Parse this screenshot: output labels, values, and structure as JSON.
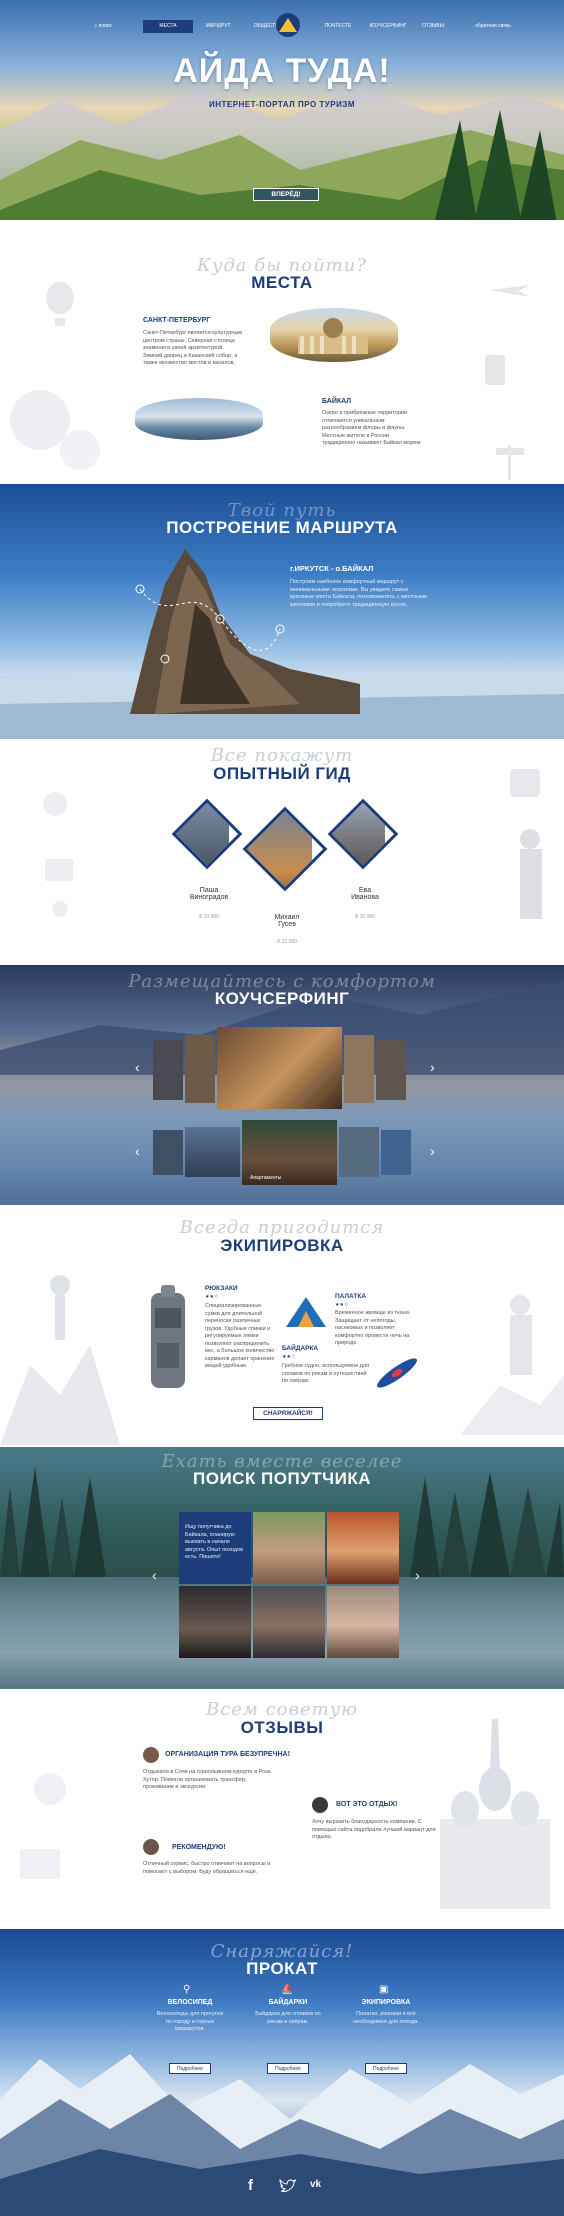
{
  "nav": {
    "search_placeholder": "поиск",
    "items": [
      "МЕСТА",
      "МАРШРУТ",
      "ОБЩЕСТВО",
      "ПОЧТЕСТЕ",
      "КОУЧСЕРФИНГ",
      "ОТЗЫВЫ"
    ],
    "callback": "обратная связь"
  },
  "hero": {
    "title": "АЙДА ТУДА!",
    "subtitle": "ИНТЕРНЕТ-ПОРТАЛ ПРО ТУРИЗМ",
    "button": "ВПЕРЁД!"
  },
  "mesta": {
    "script": "Куда бы пойти?",
    "title": "МЕСТА",
    "place1_title": "САНКТ-ПЕТЕРБУРГ",
    "place1_text": "Санкт-Петербург является культурным центром страны. Северная столица знаменита своей архитектурой. Зимний дворец и Казанский собор, а также множество мостов и каналов.",
    "place2_title": "БАЙКАЛ",
    "place2_text": "Озеро и прибрежные территории отличаются уникальным разнообразием флоры и фауны. Местные жители в России традиционно называют Байкал морем."
  },
  "marshrut": {
    "script": "Твой путь",
    "title": "ПОСТРОЕНИЕ МАРШРУТА",
    "route_title": "г.ИРКУТСК - о.БАЙКАЛ",
    "route_text": "Построим наиболее комфортный маршрут с минимальными затратами. Вы увидите самые красивые места Байкала, познакомитесь с местными жителями и попробуете традиционную кухню."
  },
  "gid": {
    "script": "Все покажут",
    "title": "ОПЫТНЫЙ ГИД",
    "guides": [
      {
        "name": "Паша\nВиноградов",
        "price": "₽ 10 000"
      },
      {
        "name": "Михаил\nГусев",
        "price": "₽ 12 000"
      },
      {
        "name": "Ева\nИванова",
        "price": "₽ 10 000"
      }
    ]
  },
  "kouch": {
    "script": "Размещайтесь с комфортом",
    "title": "КОУЧСЕРФИНГ",
    "caption": "Апартаменты"
  },
  "ekip": {
    "script": "Всегда пригодится",
    "title": "ЭКИПИРОВКА",
    "item1_title": "РЮКЗАКИ",
    "item1_text": "Специализированные сумки для длительной переноски различных грузов. Удобные спинки и регулируемые лямки позволяют распределить вес, а большое количество карманов делает хранение вещей удобным.",
    "item2_title": "ПАЛАТКА",
    "item2_text": "Временное жилище из ткани. Защищает от непогоды, насекомых и позволяет комфортно провести ночь на природе.",
    "item3_title": "БАЙДАРКА",
    "item3_text": "Гребное судно, используемое для сплавов по рекам и путешествий по озёрам.",
    "button": "СНАРЯЖАЙСЯ!"
  },
  "poisk": {
    "script": "Ехать вместе веселее",
    "title": "ПОИСК ПОПУТЧИКА",
    "card_text": "Ищу попутчика до Байкала, планирую выехать в начале августа. Опыт походов есть. Пишите!"
  },
  "otzyv": {
    "script": "Всем советую",
    "title": "ОТЗЫВЫ",
    "r1_title": "ОРГАНИЗАЦИЯ ТУРА БЕЗУПРЕЧНА!",
    "r1_text": "Отдыхали в Сочи на горнолыжном курорте в Роза Хутор. Помогли организовать трансфер, проживание и экскурсии.",
    "r2_title": "ВОТ ЭТО ОТДЫХ!",
    "r2_text": "Хочу выразить благодарность компании. С помощью сайта подобрали лучший вариант для отдыха.",
    "r3_title": "РЕКОМЕНДУЮ!",
    "r3_text": "Отличный сервис, быстро отвечают на вопросы и помогают с выбором. Буду обращаться ещё."
  },
  "prokat": {
    "script": "Снаряжайся!",
    "title": "ПРОКАТ",
    "items": [
      {
        "title": "ВЕЛОСИПЕД",
        "text": "Велосипеды для прогулок по городу и горных маршрутов.",
        "button": "Подробнее"
      },
      {
        "title": "БАЙДАРКИ",
        "text": "Байдарки для сплавов по рекам и озёрам.",
        "button": "Подробнее"
      },
      {
        "title": "ЭКИПИРОВКА",
        "text": "Палатки, рюкзаки и всё необходимое для похода.",
        "button": "Подробнее"
      }
    ]
  },
  "colors": {
    "brand": "#1d3d7a",
    "accent": "#2f6fb8"
  }
}
